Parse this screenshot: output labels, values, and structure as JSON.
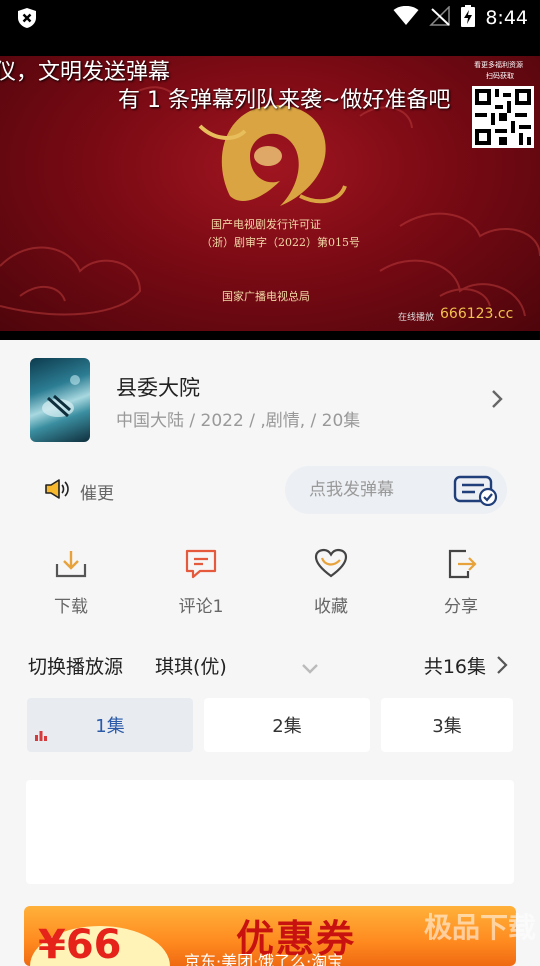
{
  "status_bar": {
    "time": "8:44"
  },
  "player": {
    "danmu_line1": "仪，文明发送弹幕",
    "danmu_line2": "有 1 条弹幕列队来袭~做好准备吧",
    "license_line1": "国产电视剧发行许可证",
    "license_line2": "（浙）剧审字（2022）第015号",
    "authority": "国家广播电视总局",
    "qr_caption1": "看更多福利资源",
    "qr_caption2": "扫码获取",
    "site_prefix": "在线播放",
    "site": "666123.cc"
  },
  "show": {
    "title": "县委大院",
    "meta": "中国大陆 / 2022 / ,剧情, / 20集"
  },
  "urge": {
    "label": "催更"
  },
  "danmu_input": {
    "placeholder": "点我发弹幕"
  },
  "actions": [
    {
      "label": "下载",
      "icon": "download-icon"
    },
    {
      "label": "评论1",
      "icon": "comment-icon"
    },
    {
      "label": "收藏",
      "icon": "heart-icon"
    },
    {
      "label": "分享",
      "icon": "share-icon"
    }
  ],
  "source": {
    "label": "切换播放源",
    "selected": "琪琪(优)",
    "total": "共16集"
  },
  "episodes": [
    {
      "label": "1集",
      "active": true
    },
    {
      "label": "2集",
      "active": false
    },
    {
      "label": "3集",
      "active": false
    }
  ],
  "banner": {
    "amount": "¥66",
    "headline": "优惠券",
    "subline": "京东·美团·饿了么·淘宝"
  },
  "watermark": "极品下载",
  "colors": {
    "accent": "#2b5aa8",
    "banner": "#ff8a1f",
    "video_bg": "#7a0a14"
  }
}
